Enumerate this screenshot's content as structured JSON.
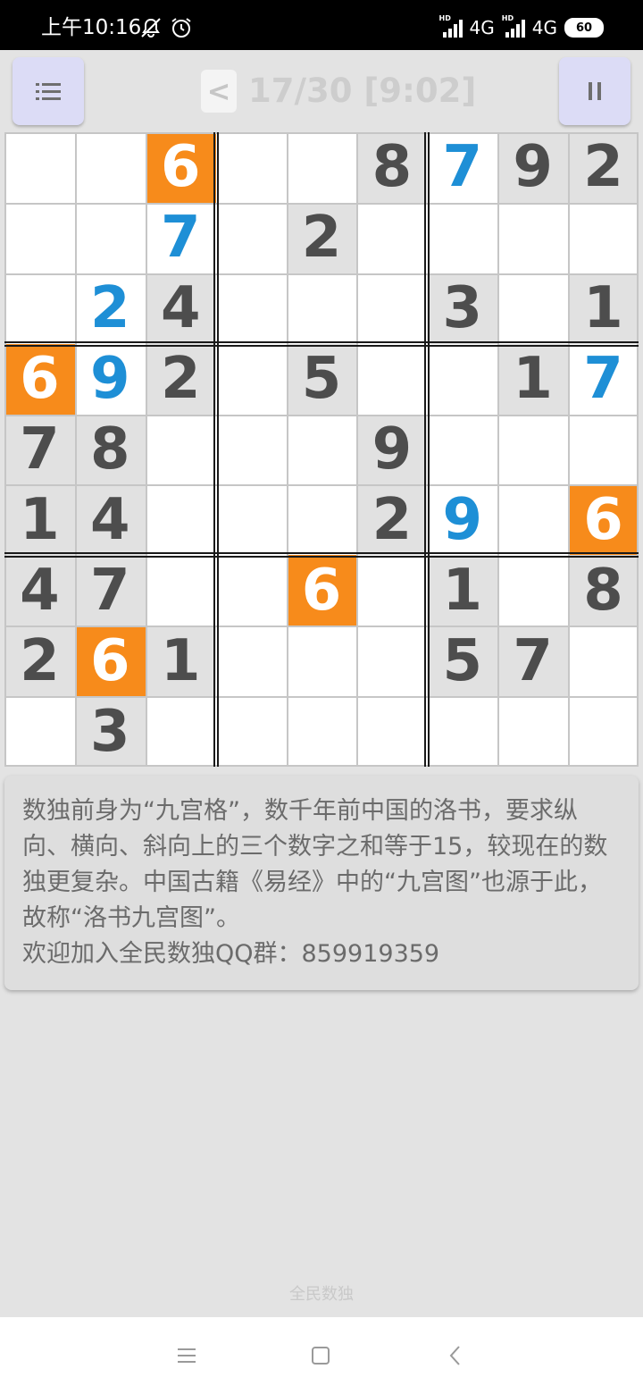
{
  "status_bar": {
    "time": "上午10:16",
    "icons": [
      "mute-icon",
      "alarm-icon",
      "hd-signal-icon",
      "hd-signal-icon",
      "battery-icon"
    ],
    "network1": "4G",
    "network2": "4G",
    "hd_label": "HD",
    "battery": "60"
  },
  "toolbar": {
    "menu_icon": "menu-icon",
    "back_label": "<",
    "progress": "17/30 [9:02]",
    "pause_icon": "pause-icon"
  },
  "sudoku": {
    "values": [
      [
        "",
        "",
        "6",
        "",
        "",
        "8",
        "7",
        "9",
        "2"
      ],
      [
        "",
        "",
        "7",
        "",
        "2",
        "",
        "",
        "",
        ""
      ],
      [
        "",
        "2",
        "4",
        "",
        "",
        "",
        "3",
        "",
        "1"
      ],
      [
        "6",
        "9",
        "2",
        "",
        "5",
        "",
        "",
        "1",
        "7"
      ],
      [
        "7",
        "8",
        "",
        "",
        "",
        "9",
        "",
        "",
        ""
      ],
      [
        "1",
        "4",
        "",
        "",
        "",
        "2",
        "9",
        "",
        "6"
      ],
      [
        "4",
        "7",
        "",
        "",
        "6",
        "",
        "1",
        "",
        "8"
      ],
      [
        "2",
        "6",
        "1",
        "",
        "",
        "",
        "5",
        "7",
        ""
      ],
      [
        "",
        "3",
        "",
        "",
        "",
        "",
        "",
        "",
        ""
      ]
    ],
    "states": [
      [
        "w",
        "w",
        "o",
        "w",
        "w",
        "g",
        "b",
        "g",
        "g"
      ],
      [
        "w",
        "w",
        "b",
        "w",
        "g",
        "w",
        "w",
        "w",
        "w"
      ],
      [
        "w",
        "b",
        "g",
        "w",
        "w",
        "w",
        "g",
        "w",
        "g"
      ],
      [
        "o",
        "b",
        "g",
        "w",
        "g",
        "w",
        "w",
        "g",
        "b"
      ],
      [
        "g",
        "g",
        "w",
        "w",
        "w",
        "g",
        "w",
        "w",
        "w"
      ],
      [
        "g",
        "g",
        "w",
        "w",
        "w",
        "g",
        "b",
        "w",
        "o"
      ],
      [
        "g",
        "g",
        "w",
        "w",
        "o",
        "w",
        "g",
        "w",
        "g"
      ],
      [
        "g",
        "o",
        "g",
        "w",
        "w",
        "w",
        "g",
        "g",
        "w"
      ],
      [
        "w",
        "g",
        "w",
        "w",
        "w",
        "w",
        "w",
        "w",
        "w"
      ]
    ],
    "colors": {
      "given_bg": "#e1e1e1",
      "given_text": "#4d4d4d",
      "highlight_bg": "#f78b1b",
      "user_text": "#1e8fd6",
      "empty_bg": "#ffffff"
    }
  },
  "info_panel": {
    "text": "数独前身为“九宫格”，数千年前中国的洛书，要求纵向、横向、斜向上的三个数字之和等于15，较现在的数独更复杂。中国古籍《易经》中的“九宫图”也源于此，故称“洛书九宫图”。\n欢迎加入全民数独QQ群：859919359"
  },
  "footer": {
    "label": "全民数独"
  },
  "nav_bar": {
    "icons": [
      "recents-icon",
      "home-icon",
      "back-icon"
    ]
  }
}
